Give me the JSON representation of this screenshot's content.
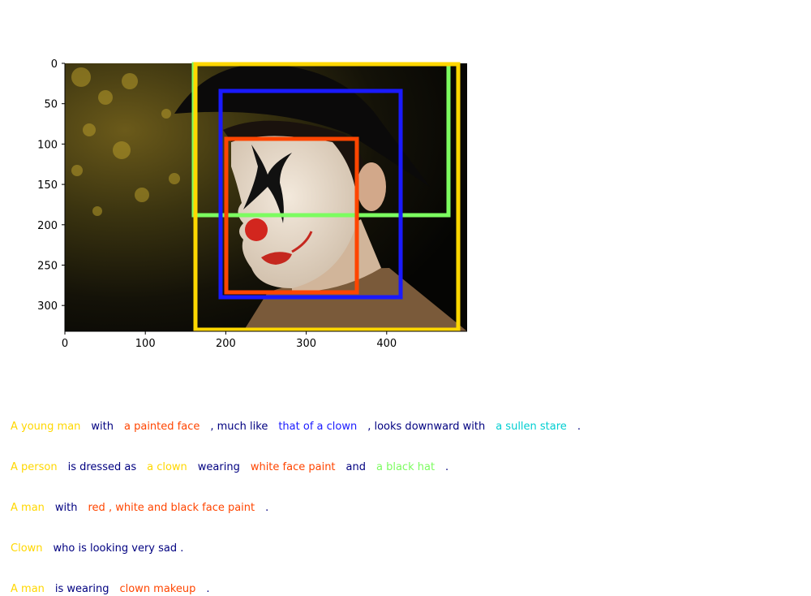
{
  "colors": {
    "yellow": "#FFD700",
    "navy": "#000080",
    "orange": "#FF4500",
    "blue": "#1A1AFF",
    "cyan": "#00CED1",
    "green": "#7CFC60"
  },
  "axes": {
    "x_ticks": [
      "0",
      "100",
      "200",
      "300",
      "400"
    ],
    "y_ticks": [
      "0",
      "50",
      "100",
      "150",
      "200",
      "250",
      "300"
    ]
  },
  "image": {
    "description_icon": "photo-clown-face-icon"
  },
  "boxes": [
    {
      "label": "green-box",
      "color": "#7CFC60"
    },
    {
      "label": "yellow-box",
      "color": "#FFD700"
    },
    {
      "label": "blue-box",
      "color": "#1A1AFF"
    },
    {
      "label": "orange-box",
      "color": "#FF4500"
    }
  ],
  "captions": [
    [
      {
        "text": "A young man",
        "color": "#FFD700"
      },
      {
        "text": "with",
        "color": "#000080"
      },
      {
        "text": "a painted face",
        "color": "#FF4500"
      },
      {
        "text": ", much like",
        "color": "#000080"
      },
      {
        "text": "that of a clown",
        "color": "#1A1AFF"
      },
      {
        "text": ", looks downward with",
        "color": "#000080"
      },
      {
        "text": "a sullen stare",
        "color": "#00CED1"
      },
      {
        "text": ".",
        "color": "#000080"
      }
    ],
    [
      {
        "text": "A person",
        "color": "#FFD700"
      },
      {
        "text": "is dressed as",
        "color": "#000080"
      },
      {
        "text": "a clown",
        "color": "#FFD700"
      },
      {
        "text": "wearing",
        "color": "#000080"
      },
      {
        "text": "white face paint",
        "color": "#FF4500"
      },
      {
        "text": "and",
        "color": "#000080"
      },
      {
        "text": "a black hat",
        "color": "#7CFC60"
      },
      {
        "text": ".",
        "color": "#000080"
      }
    ],
    [
      {
        "text": "A man",
        "color": "#FFD700"
      },
      {
        "text": "with",
        "color": "#000080"
      },
      {
        "text": "red , white and black face paint",
        "color": "#FF4500"
      },
      {
        "text": ".",
        "color": "#000080"
      }
    ],
    [
      {
        "text": "Clown",
        "color": "#FFD700"
      },
      {
        "text": "who is looking very sad .",
        "color": "#000080"
      }
    ],
    [
      {
        "text": "A man",
        "color": "#FFD700"
      },
      {
        "text": "is wearing",
        "color": "#000080"
      },
      {
        "text": "clown makeup",
        "color": "#FF4500"
      },
      {
        "text": ".",
        "color": "#000080"
      }
    ]
  ]
}
